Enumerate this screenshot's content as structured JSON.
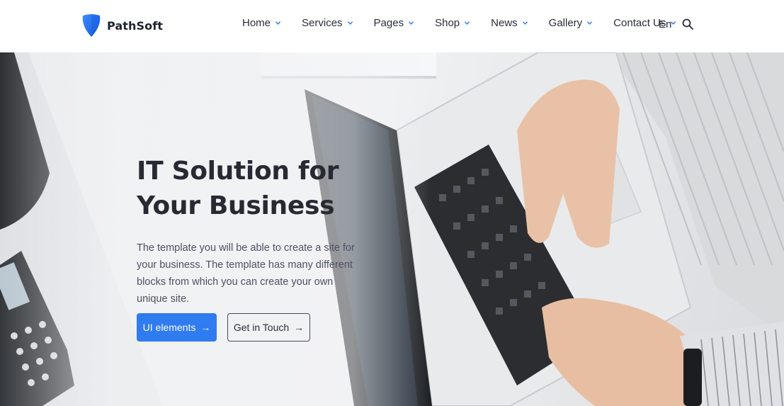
{
  "brand": {
    "name": "PathSoft",
    "accent": "#2f7bf0"
  },
  "nav": {
    "items": [
      {
        "label": "Home",
        "icon": "chevron-down-icon"
      },
      {
        "label": "Services",
        "icon": "chevron-down-icon"
      },
      {
        "label": "Pages",
        "icon": "chevron-down-icon"
      },
      {
        "label": "Shop",
        "icon": "chevron-down-icon"
      },
      {
        "label": "News",
        "icon": "chevron-down-icon"
      },
      {
        "label": "Gallery",
        "icon": "chevron-down-icon"
      },
      {
        "label": "Contact Us",
        "icon": "chevron-down-icon"
      }
    ],
    "language": "En",
    "search_icon": "search-icon"
  },
  "hero": {
    "title": "IT Solution for Your Business",
    "description": "The template you will be able to create a site for your business. The template has many different blocks from which you can create your own unique site.",
    "primary_button": "UI elements",
    "secondary_button": "Get in Touch",
    "button_icon": "arrow-right-icon"
  }
}
